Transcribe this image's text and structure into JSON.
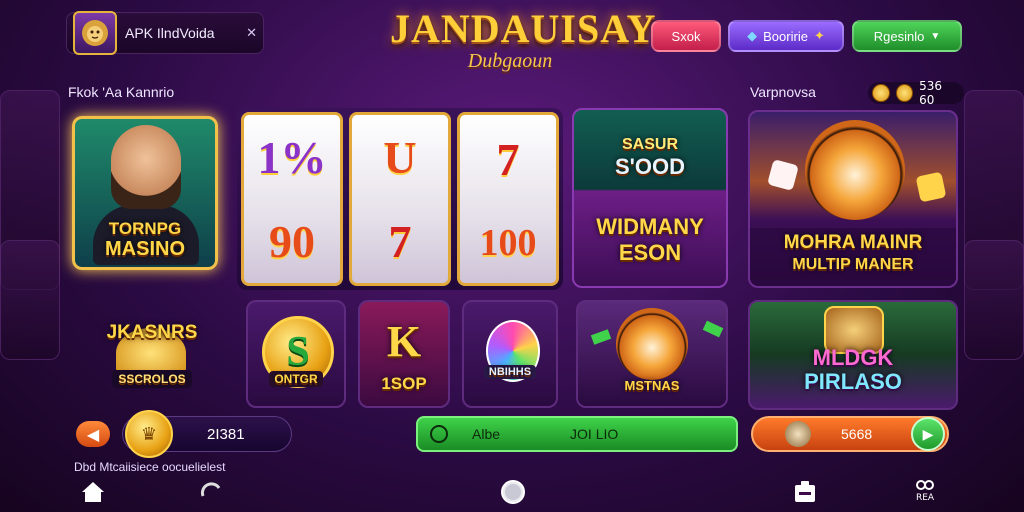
{
  "header": {
    "app_title": "APK IlndVoida",
    "close_symbol": "✕",
    "logo_main": "JANDAUISAY",
    "logo_sub": "Dubgaoun",
    "buttons": {
      "slot": "Sxok",
      "bonus": "Booririe",
      "register": "Rgesinlo"
    }
  },
  "sections": {
    "left_label": "Fkok 'Aa Kannrio",
    "right_label": "Varpnovsa",
    "coin_value": "536 60"
  },
  "cards": {
    "hero": {
      "line1": "TORNPG",
      "line2": "MASINO"
    },
    "reels": [
      {
        "top": "1%",
        "bottom": "90"
      },
      {
        "top": "U",
        "bottom": "7"
      },
      {
        "top": "7",
        "bottom": "100"
      }
    ],
    "seasons": {
      "top1": "SASUR",
      "top2": "S'OOD",
      "bottom1": "WIDMANY",
      "bottom2": "ESON"
    },
    "tiger": {
      "line1": "MOHRA MAINR",
      "line2": "MULTIP MANER"
    },
    "jackpot": {
      "line1": "JKASNRS",
      "line2": "SSCROLOS"
    },
    "small_s": {
      "symbol": "S",
      "label": "ONTGR"
    },
    "small_k": {
      "symbol": "K",
      "label": "1SOP"
    },
    "small_ball": {
      "label": "NBIHHS"
    },
    "small_tiger": {
      "label": "MSTNAS"
    },
    "magic": {
      "line1": "MLDGK",
      "line2": "PIRLASO"
    }
  },
  "bottom_bar": {
    "balance": "2I381",
    "green_left": "Albe",
    "green_right": "JOI LIO",
    "play_value": "5668",
    "footer": "Dbd Mtcaiisiece oocuelielest",
    "nav_label": "REA"
  },
  "icons": {
    "app": "lion-icon",
    "bonus": "gem-icon",
    "register": "chevron-down-icon",
    "home": "home-icon",
    "refresh": "refresh-icon",
    "circle": "circle-icon",
    "card": "card-icon",
    "settings": "gear-icon"
  }
}
